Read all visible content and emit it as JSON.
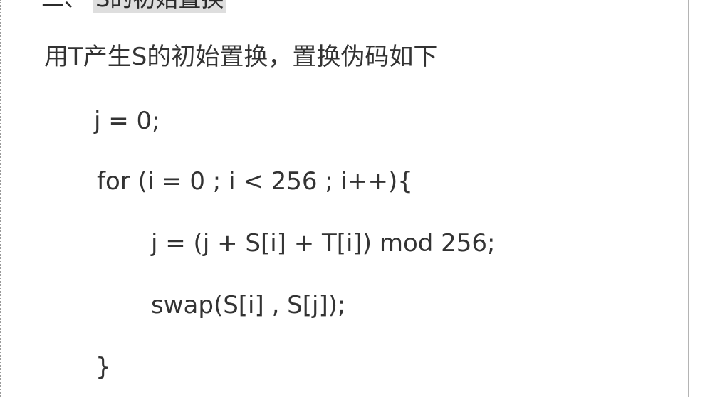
{
  "heading": {
    "number": "二、",
    "text": "S的初始置换"
  },
  "intro": "用T产生S的初始置换，置换伪码如下",
  "code": [
    "j = 0;",
    "for (i = 0 ; i < 256 ; i++){",
    "j = (j + S[i] + T[i]) mod 256;",
    "swap(S[i] , S[j]);",
    "}"
  ]
}
